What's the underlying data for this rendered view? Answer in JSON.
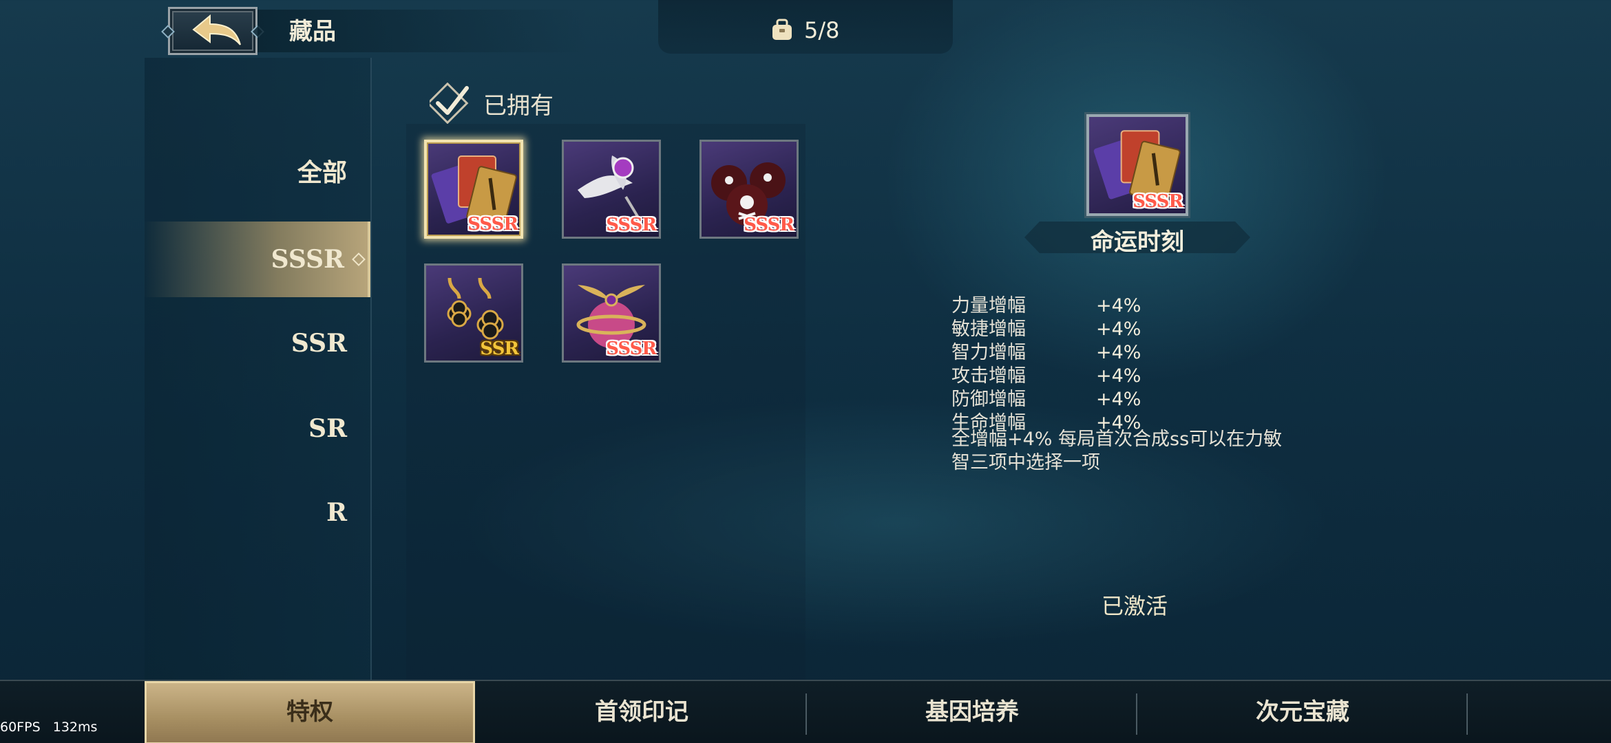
{
  "header": {
    "title": "藏品",
    "collection_count": "5/8"
  },
  "categories": [
    {
      "label": "全部"
    },
    {
      "label": "SSSR"
    },
    {
      "label": "SSR"
    },
    {
      "label": "SR"
    },
    {
      "label": "R"
    }
  ],
  "active_category": "SSSR",
  "filter": {
    "owned_label": "已拥有",
    "checked": true
  },
  "items": [
    {
      "name": "cards",
      "rarity": "SSSR",
      "selected": true
    },
    {
      "name": "feather-brooch",
      "rarity": "SSSR",
      "selected": false
    },
    {
      "name": "skull-bombs",
      "rarity": "SSSR",
      "selected": false
    },
    {
      "name": "clover-earrings",
      "rarity": "SSR",
      "selected": false
    },
    {
      "name": "winged-orb",
      "rarity": "SSSR",
      "selected": false
    }
  ],
  "detail": {
    "name": "命运时刻",
    "rarity": "SSSR",
    "stats": [
      {
        "name": "力量增幅",
        "value": "+4%"
      },
      {
        "name": "敏捷增幅",
        "value": "+4%"
      },
      {
        "name": "智力增幅",
        "value": "+4%"
      },
      {
        "name": "攻击增幅",
        "value": "+4%"
      },
      {
        "name": "防御增幅",
        "value": "+4%"
      },
      {
        "name": "生命增幅",
        "value": "+4%"
      }
    ],
    "description_line1": "全增幅+4% 每局首次合成ss可以在力敏",
    "description_line2": "智三项中选择一项",
    "status": "已激活"
  },
  "tabs": [
    {
      "label": "特权",
      "active": true
    },
    {
      "label": "首领印记",
      "active": false
    },
    {
      "label": "基因培养",
      "active": false
    },
    {
      "label": "次元宝藏",
      "active": false
    }
  ],
  "debug": {
    "fps": "60FPS",
    "latency": "132ms"
  },
  "colors": {
    "accent_gold": "#cdb68a",
    "sssr_red": "#ff5a4a",
    "ssr_gold": "#f3c53a"
  }
}
